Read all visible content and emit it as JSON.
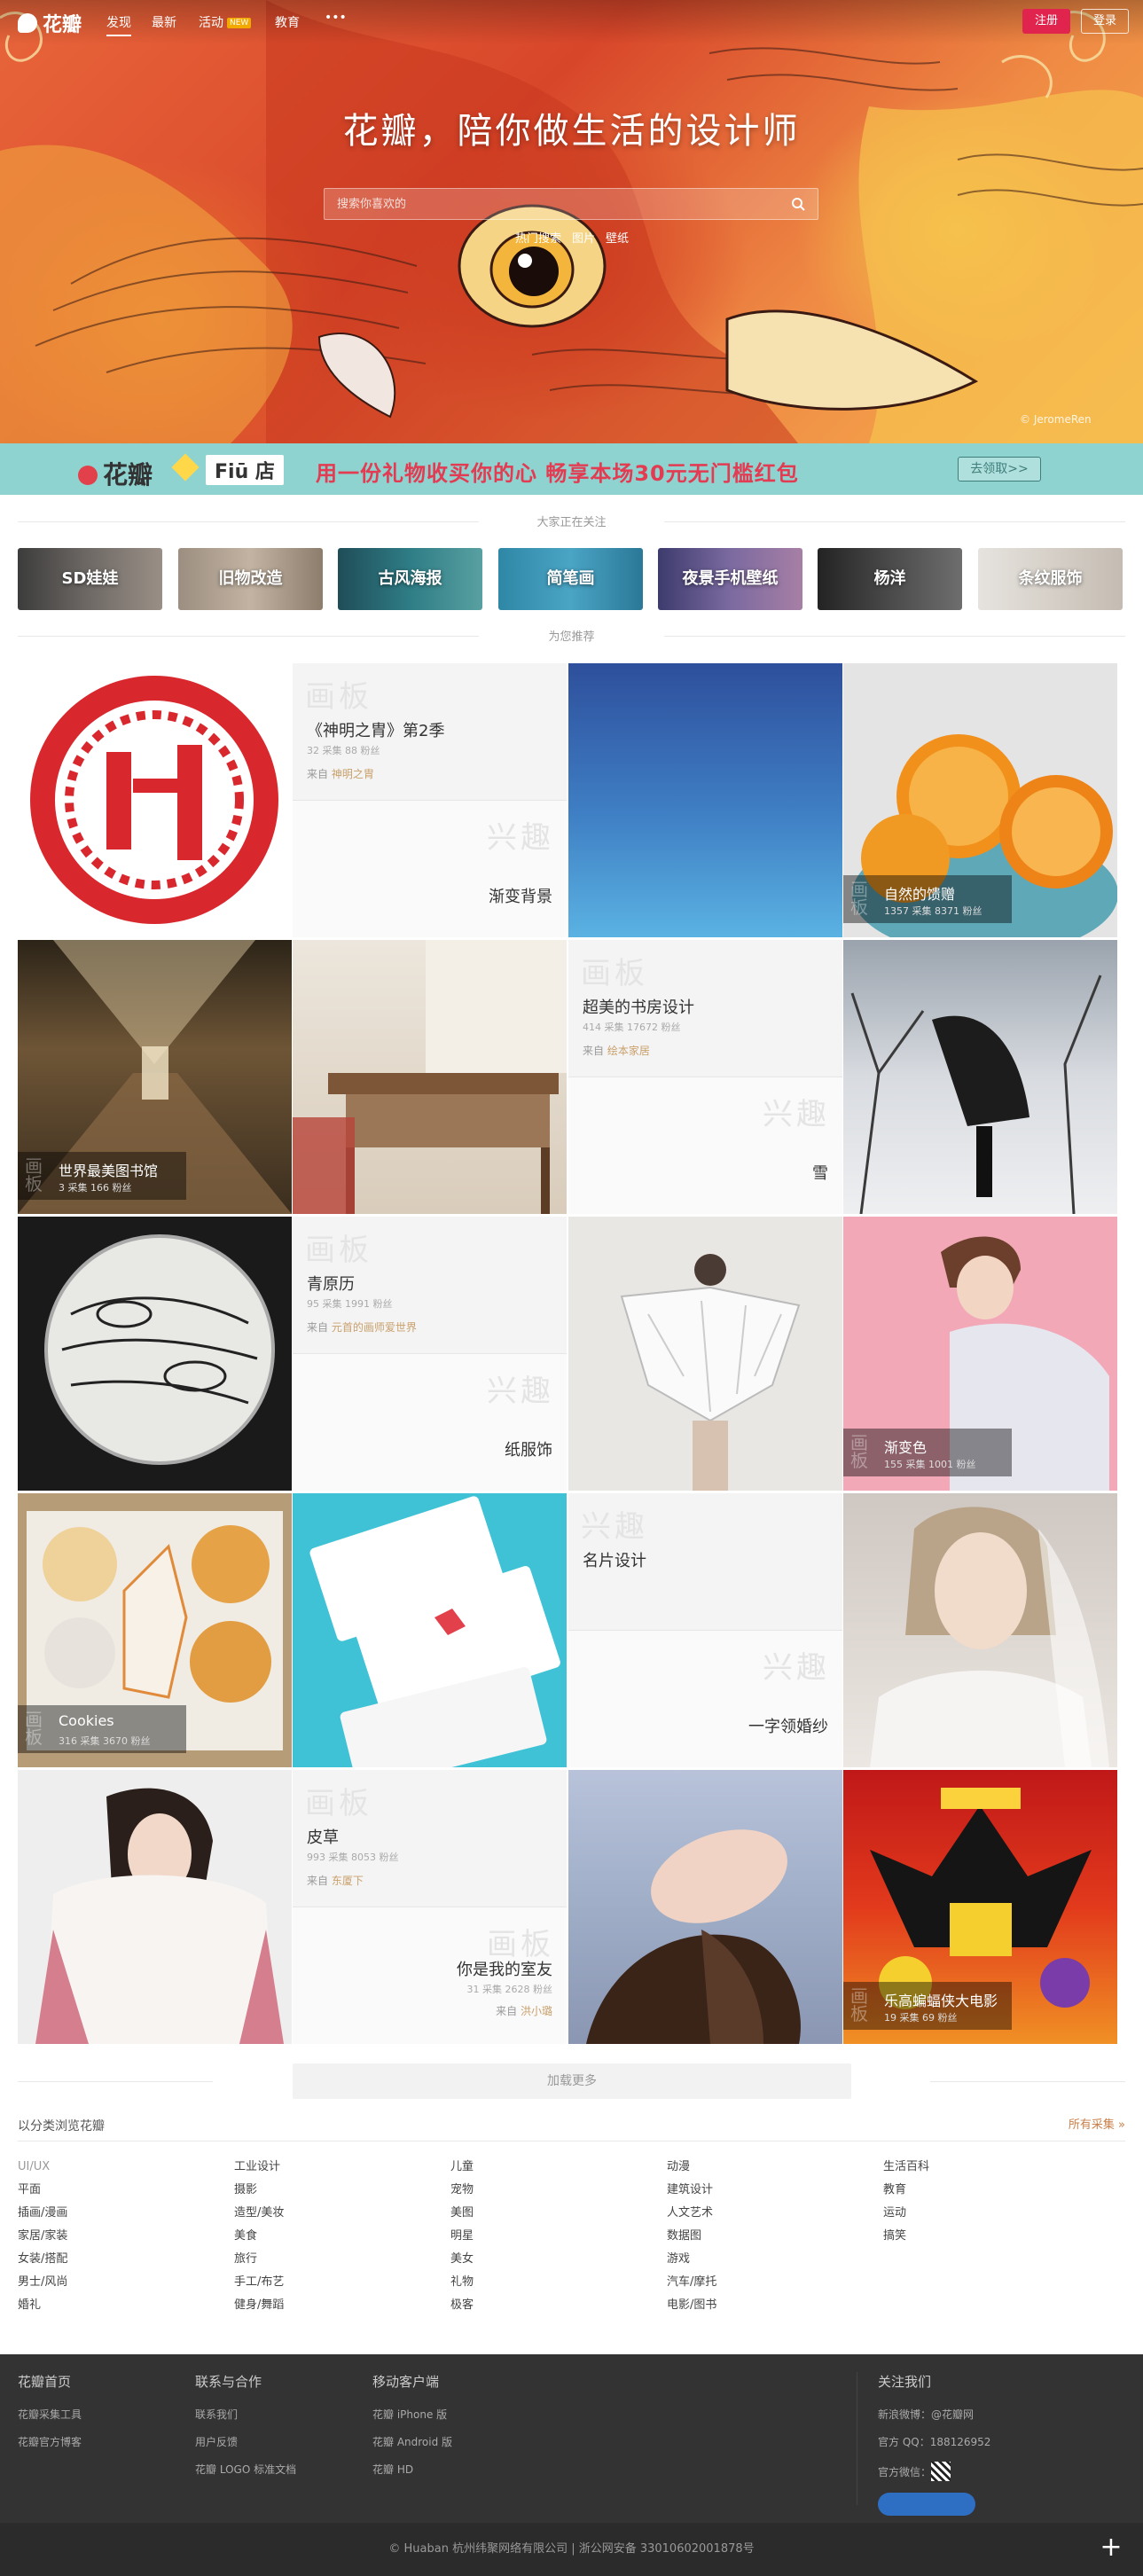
{
  "nav": {
    "logo": "花瓣",
    "items": [
      "发现",
      "最新",
      "活动",
      "NEW",
      "教育",
      "•••"
    ],
    "register": "注册",
    "login": "登录"
  },
  "hero": {
    "slogan": "花瓣，陪你做生活的设计师",
    "search_placeholder": "搜索你喜欢的",
    "hot": [
      "热门搜索",
      "图片",
      "壁纸"
    ],
    "credit": "© JeromeRen"
  },
  "banner": {
    "logo": "花瓣",
    "partner": "Fiū",
    "partner_suffix": "店",
    "text": "用一份礼物收买你的心   畅享本场30元无门槛红包",
    "button": "去领取>>"
  },
  "sections": {
    "following": "大家正在关注",
    "recommend": "为您推荐"
  },
  "following": [
    "SD娃娃",
    "旧物改造",
    "古风海报",
    "简笔画",
    "夜景手机壁纸",
    "杨洋",
    "条纹服饰"
  ],
  "tiles": [
    {
      "board": "画板",
      "title": "《神明之胄》第2季",
      "meta": "32 采集   88 粉丝",
      "from": "来自",
      "from_name": "神明之胄",
      "lower_wm": "兴趣",
      "lower_title": "渐变背景"
    },
    {
      "caption": "自然的馈赠",
      "caption_meta": "1357 采集   8371 粉丝",
      "cw": "画板"
    },
    {
      "caption": "世界最美图书馆",
      "caption_meta": "3 采集   166 粉丝",
      "cw": "画板"
    },
    {
      "board": "画板",
      "title": "超美的书房设计",
      "meta": "414 采集   17672 粉丝",
      "from": "来自",
      "from_name": "绘本家居",
      "lower_wm": "兴趣",
      "lower_title": "雪"
    },
    {
      "board": "画板",
      "title": "青原历",
      "meta": "95 采集   1991 粉丝",
      "from": "来自",
      "from_name": "元首的画师爱世界",
      "lower_wm": "兴趣",
      "lower_title": "纸服饰"
    },
    {
      "caption": "渐变色",
      "caption_meta": "155 采集   1001 粉丝",
      "cw": "画板"
    },
    {
      "caption": "Cookies",
      "caption_meta": "316 采集   3670 粉丝",
      "cw": "画板"
    },
    {
      "board": "兴趣",
      "title": "名片设计",
      "lower_wm": "兴趣",
      "lower_title": "一字领婚纱"
    },
    {
      "board": "画板",
      "title": "皮草",
      "meta": "993 采集   8053 粉丝",
      "from": "来自",
      "from_name": "东厦下",
      "lower_wm": "画板",
      "lower_title": "你是我的室友",
      "lower_meta": "31 采集   2628 粉丝",
      "lower_from": "来自",
      "lower_from_name": "洪小璐"
    },
    {
      "caption": "乐高蝙蝠侠大电影",
      "caption_meta": "19 采集   69 粉丝",
      "cw": "画板"
    }
  ],
  "loadmore": "加载更多",
  "categories": {
    "title": "以分类浏览花瓣",
    "more": "所有采集 »",
    "cols": [
      [
        "UI/UX",
        "平面",
        "插画/漫画",
        "家居/家装",
        "女装/搭配",
        "男士/风尚",
        "婚礼"
      ],
      [
        "工业设计",
        "摄影",
        "造型/美妆",
        "美食",
        "旅行",
        "手工/布艺",
        "健身/舞蹈"
      ],
      [
        "儿童",
        "宠物",
        "美图",
        "明星",
        "美女",
        "礼物",
        "极客"
      ],
      [
        "动漫",
        "建筑设计",
        "人文艺术",
        "数据图",
        "游戏",
        "汽车/摩托",
        "电影/图书"
      ],
      [
        "生活百科",
        "教育",
        "运动",
        "搞笑"
      ]
    ]
  },
  "footer": {
    "cols": [
      {
        "h": "花瓣首页",
        "items": [
          "花瓣采集工具",
          "花瓣官方博客"
        ]
      },
      {
        "h": "联系与合作",
        "items": [
          "联系我们",
          "用户反馈",
          "花瓣 LOGO 标准文档"
        ]
      },
      {
        "h": "移动客户端",
        "items": [
          "花瓣 iPhone 版",
          "花瓣 Android 版",
          "花瓣 HD"
        ]
      },
      {
        "h": "关注我们",
        "items": [
          "新浪微博：@花瓣网",
          "官方 QQ：188126952",
          "官方微信："
        ]
      }
    ],
    "bottom": "© Huaban 杭州纬聚网络有限公司  |  浙公网安备 33010602001878号",
    "plus": "+"
  },
  "colors": {
    "brand": "#e1244e",
    "banner": "#8ed3cf",
    "footer": "#333333"
  }
}
